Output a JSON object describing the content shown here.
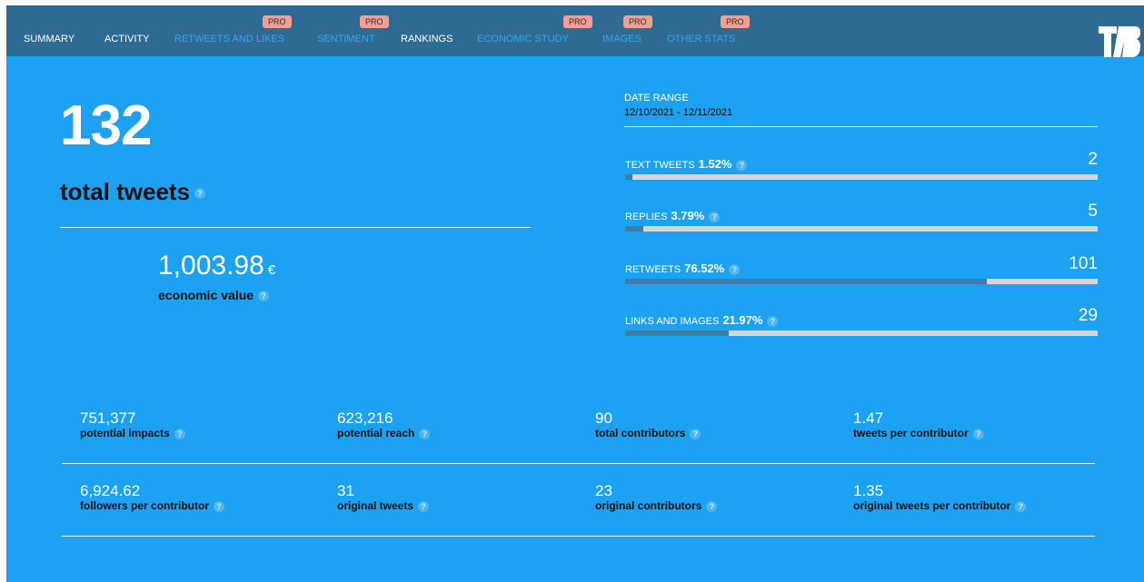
{
  "nav": {
    "items": [
      {
        "label": "SUMMARY",
        "pro": false,
        "active": true
      },
      {
        "label": "ACTIVITY",
        "pro": false,
        "active": true
      },
      {
        "label": "RETWEETS AND LIKES",
        "pro": true,
        "active": false
      },
      {
        "label": "SENTIMENT",
        "pro": true,
        "active": false
      },
      {
        "label": "RANKINGS",
        "pro": false,
        "active": true
      },
      {
        "label": "ECONOMIC STUDY",
        "pro": true,
        "active": false
      },
      {
        "label": "IMAGES",
        "pro": true,
        "active": false
      },
      {
        "label": "OTHER STATS",
        "pro": true,
        "active": false
      }
    ],
    "pro_badge": "PRO",
    "logo_icon": "tb-logo-icon"
  },
  "summary": {
    "total_tweets": "132",
    "total_tweets_label": "total tweets",
    "economic_value": "1,003.98",
    "currency": "€",
    "economic_value_label": "economic value"
  },
  "date_range": {
    "title": "DATE RANGE",
    "value": "12/10/2021 - 12/11/2021"
  },
  "breakdown": [
    {
      "label": "TEXT TWEETS",
      "percent": "1.52%",
      "count": "2",
      "fill": 0.0152
    },
    {
      "label": "REPLIES",
      "percent": "3.79%",
      "count": "5",
      "fill": 0.0379
    },
    {
      "label": "RETWEETS",
      "percent": "76.52%",
      "count": "101",
      "fill": 0.7652
    },
    {
      "label": "LINKS AND IMAGES",
      "percent": "21.97%",
      "count": "29",
      "fill": 0.2197
    }
  ],
  "metrics": [
    {
      "value": "751,377",
      "label": "potential impacts"
    },
    {
      "value": "623,216",
      "label": "potential reach"
    },
    {
      "value": "90",
      "label": "total contributors"
    },
    {
      "value": "1.47",
      "label": "tweets per contributor"
    },
    {
      "value": "6,924.62",
      "label": "followers per contributor"
    },
    {
      "value": "31",
      "label": "original tweets"
    },
    {
      "value": "23",
      "label": "original contributors"
    },
    {
      "value": "1.35",
      "label": "original tweets per contributor"
    }
  ],
  "help_glyph": "?",
  "colors": {
    "background": "#1da1f2",
    "nav_bar": "#2e6a91",
    "pro_badge": "#f39e92",
    "bar_fill": "#3f7ea6",
    "bar_track": "#d6d6d6"
  }
}
